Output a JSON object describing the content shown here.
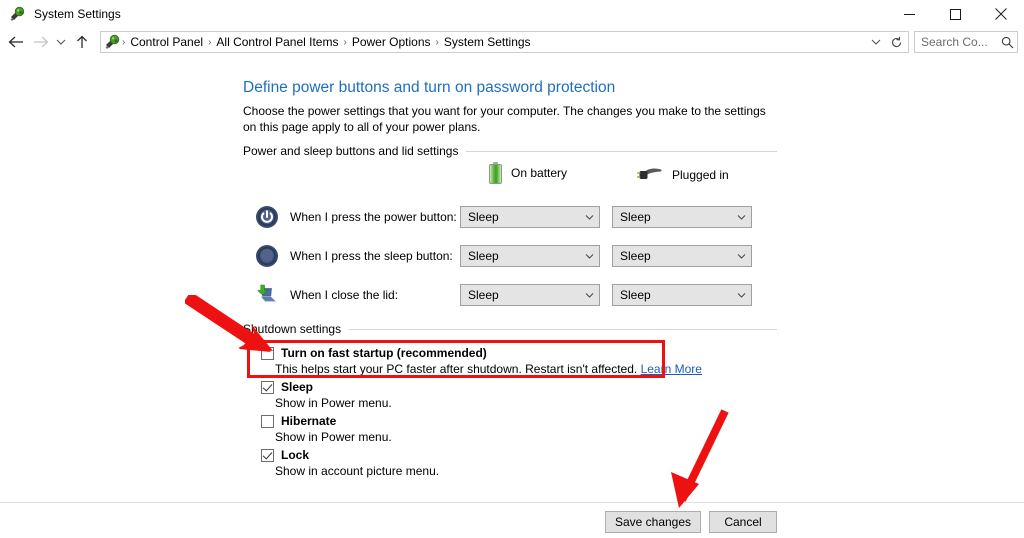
{
  "window": {
    "title": "System Settings",
    "icon": "system-settings-icon",
    "controls": {
      "minimize": "minimize-icon",
      "maximize": "maximize-icon",
      "close": "close-icon"
    }
  },
  "nav": {
    "back": "back-arrow-icon",
    "forward": "forward-arrow-icon",
    "recent": "recent-locations-chevron-icon",
    "up": "up-arrow-icon",
    "breadcrumbs": [
      "Control Panel",
      "All Control Panel Items",
      "Power Options",
      "System Settings"
    ],
    "separator": "›",
    "dropdown": "address-dropdown-icon",
    "refresh": "refresh-icon"
  },
  "search": {
    "value": "Search Co...",
    "placeholder": "Search Control Panel",
    "icon": "search-icon"
  },
  "page": {
    "title": "Define power buttons and turn on password protection",
    "description": "Choose the power settings that you want for your computer. The changes you make to the settings on this page apply to all of your power plans."
  },
  "groups": {
    "power_sleep_lid": "Power and sleep buttons and lid settings",
    "shutdown": "Shutdown settings"
  },
  "columns": [
    {
      "label": "On battery",
      "icon": "battery-icon"
    },
    {
      "label": "Plugged in",
      "icon": "power-plug-icon"
    }
  ],
  "settings_rows": [
    {
      "icon": "power-button-icon",
      "label": "When I press the power button:",
      "on_battery": "Sleep",
      "plugged_in": "Sleep"
    },
    {
      "icon": "sleep-button-icon",
      "label": "When I press the sleep button:",
      "on_battery": "Sleep",
      "plugged_in": "Sleep"
    },
    {
      "icon": "close-lid-icon",
      "label": "When I close the lid:",
      "on_battery": "Sleep",
      "plugged_in": "Sleep"
    }
  ],
  "shutdown_options": [
    {
      "label": "Turn on fast startup (recommended)",
      "checked": false,
      "description": "This helps start your PC faster after shutdown. Restart isn't affected.",
      "link": "Learn More",
      "highlighted": true
    },
    {
      "label": "Sleep",
      "checked": true,
      "description": "Show in Power menu.",
      "link": "",
      "highlighted": false
    },
    {
      "label": "Hibernate",
      "checked": false,
      "description": "Show in Power menu.",
      "link": "",
      "highlighted": false
    },
    {
      "label": "Lock",
      "checked": true,
      "description": "Show in account picture menu.",
      "link": "",
      "highlighted": false
    }
  ],
  "footer": {
    "save_label": "Save changes",
    "cancel_label": "Cancel"
  },
  "annotations": {
    "accent_color": "#ee1111",
    "arrow_1": "red-arrow-pointing-to-fast-startup",
    "arrow_2": "red-arrow-pointing-to-save-changes"
  }
}
